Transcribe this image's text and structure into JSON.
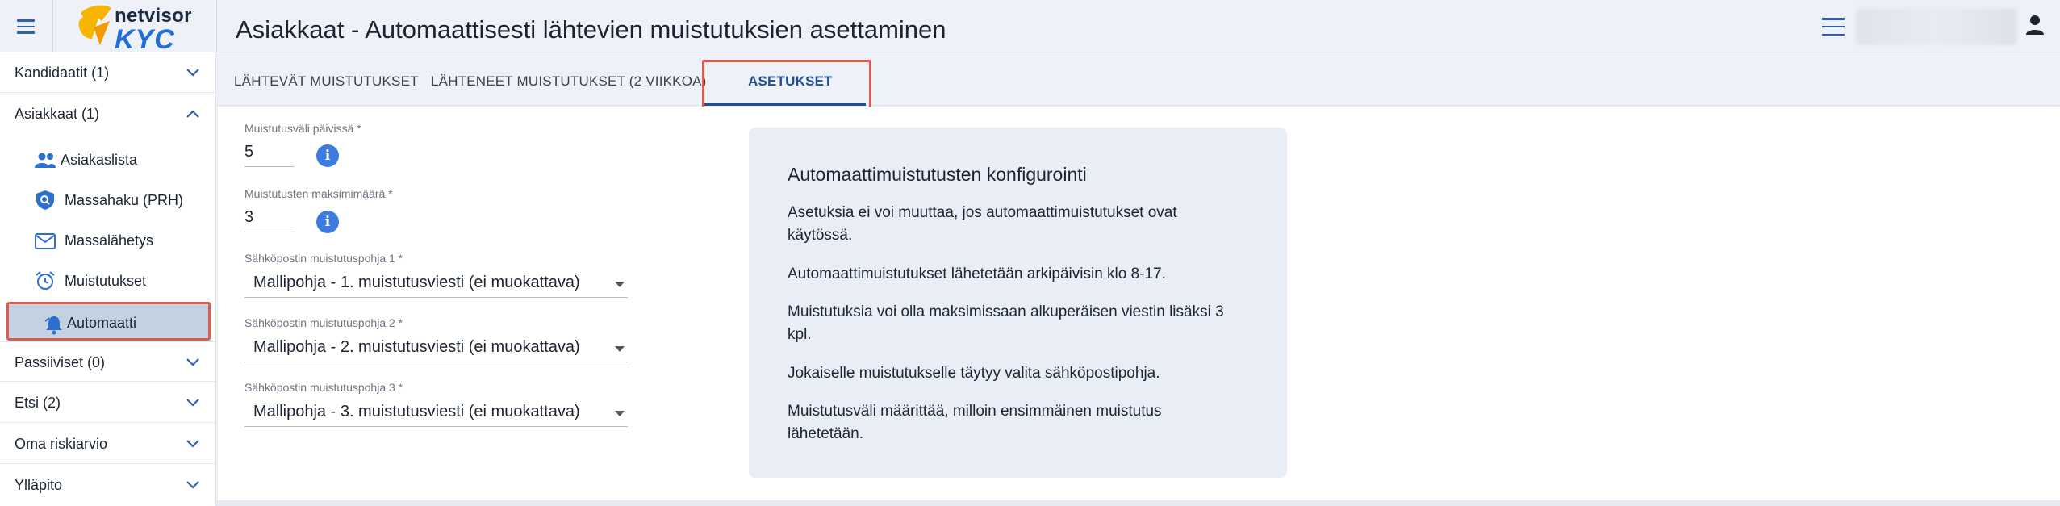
{
  "app": {
    "logo_top": "netvisor",
    "logo_bottom": "KYC",
    "page_title": "Asiakkaat - Automaattisesti lähtevien muistutuksien asettaminen"
  },
  "icons": {
    "menu": "hamburger-menu-icon",
    "top_right_menu": "list-menu-icon",
    "user": "user-account-icon",
    "customer_list": "people-icon",
    "mass_search": "shield-search-icon",
    "mass_send": "mail-icon",
    "reminders": "alarm-clock-icon",
    "automation": "robot-bell-icon",
    "info": "info-icon",
    "chevron": "chevron-icon"
  },
  "colors": {
    "accent": "#1f4f90",
    "brand_blue": "#1f6fd6",
    "brand_yellow": "#f6b600",
    "highlight_border": "#e05a4e",
    "active_item_bg": "#c3d1e2",
    "info_card_bg": "#e9eef6"
  },
  "sidebar": {
    "groups": [
      {
        "label": "Kandidaatit (1)",
        "expanded": false
      },
      {
        "label": "Asiakkaat (1)",
        "expanded": true
      },
      {
        "label": "Passiiviset (0)",
        "expanded": false
      },
      {
        "label": "Etsi (2)",
        "expanded": false
      },
      {
        "label": "Oma riskiarvio",
        "expanded": false
      },
      {
        "label": "Ylläpito",
        "expanded": false
      }
    ],
    "items": [
      {
        "label": "Asiakaslista"
      },
      {
        "label": "Massahaku (PRH)"
      },
      {
        "label": "Massalähetys"
      },
      {
        "label": "Muistutukset"
      },
      {
        "label": "Automaatti",
        "active": true
      }
    ]
  },
  "tabs": [
    {
      "label": "LÄHTEVÄT MUISTUTUKSET"
    },
    {
      "label": "LÄHTENEET MUISTUTUKSET (2 VIIKKOA)"
    },
    {
      "label": "ASETUKSET",
      "active": true
    }
  ],
  "form": {
    "interval_label": "Muistutusväli päivissä *",
    "interval_value": "5",
    "max_label": "Muistutusten maksimimäärä *",
    "max_value": "3",
    "template1_label": "Sähköpostin muistutuspohja 1 *",
    "template1_value": "Mallipohja - 1. muistutusviesti (ei muokattava)",
    "template2_label": "Sähköpostin muistutuspohja 2 *",
    "template2_value": "Mallipohja - 2. muistutusviesti (ei muokattava)",
    "template3_label": "Sähköpostin muistutuspohja 3 *",
    "template3_value": "Mallipohja - 3. muistutusviesti (ei muokattava)"
  },
  "info_card": {
    "title": "Automaattimuistutusten konfigurointi",
    "paragraphs": [
      "Asetuksia ei voi muuttaa, jos automaattimuistutukset ovat käytössä.",
      "Automaattimuistutukset lähetetään arkipäivisin klo 8-17.",
      "Muistutuksia voi olla maksimissaan alkuperäisen viestin lisäksi 3 kpl.",
      "Jokaiselle muistutukselle täytyy valita sähköpostipohja.",
      "Muistutusväli määrittää, milloin ensimmäinen muistutus lähetetään."
    ]
  }
}
